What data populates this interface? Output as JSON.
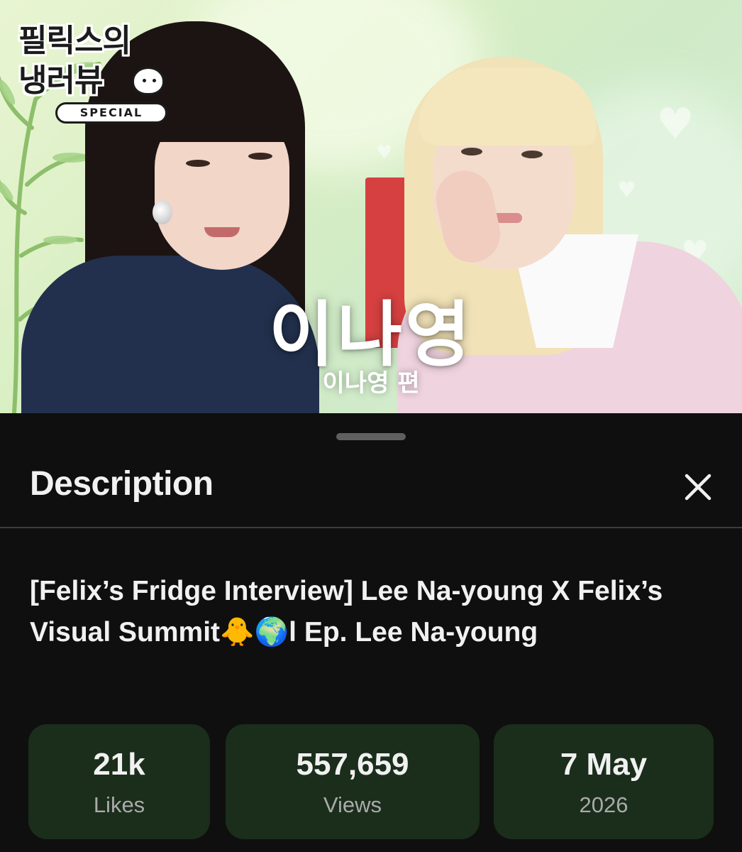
{
  "thumbnail": {
    "logo_line1": "필릭스의",
    "logo_line2": "냉러뷰",
    "logo_special": "SPECIAL",
    "big_name": "이나영",
    "small_name": "이나영 편",
    "colors": {
      "bg_green": "#d9efc4",
      "heart": "#f5fbf3",
      "text": "#ffffff"
    }
  },
  "sheet": {
    "title": "Description",
    "close_icon": "close-icon",
    "video_title": "[Felix’s Fridge Interview] Lee Na-young X Felix’s Visual Summit🐥🌍l Ep. Lee Na-young",
    "stats": [
      {
        "value": "21k",
        "label": "Likes"
      },
      {
        "value": "557,659",
        "label": "Views"
      },
      {
        "value": "7 May",
        "label": "2026"
      }
    ],
    "colors": {
      "background": "#0f0f0f",
      "stat_card": "#1b2d1b",
      "label": "#aaaaaa",
      "divider": "#3d3d3d"
    }
  }
}
